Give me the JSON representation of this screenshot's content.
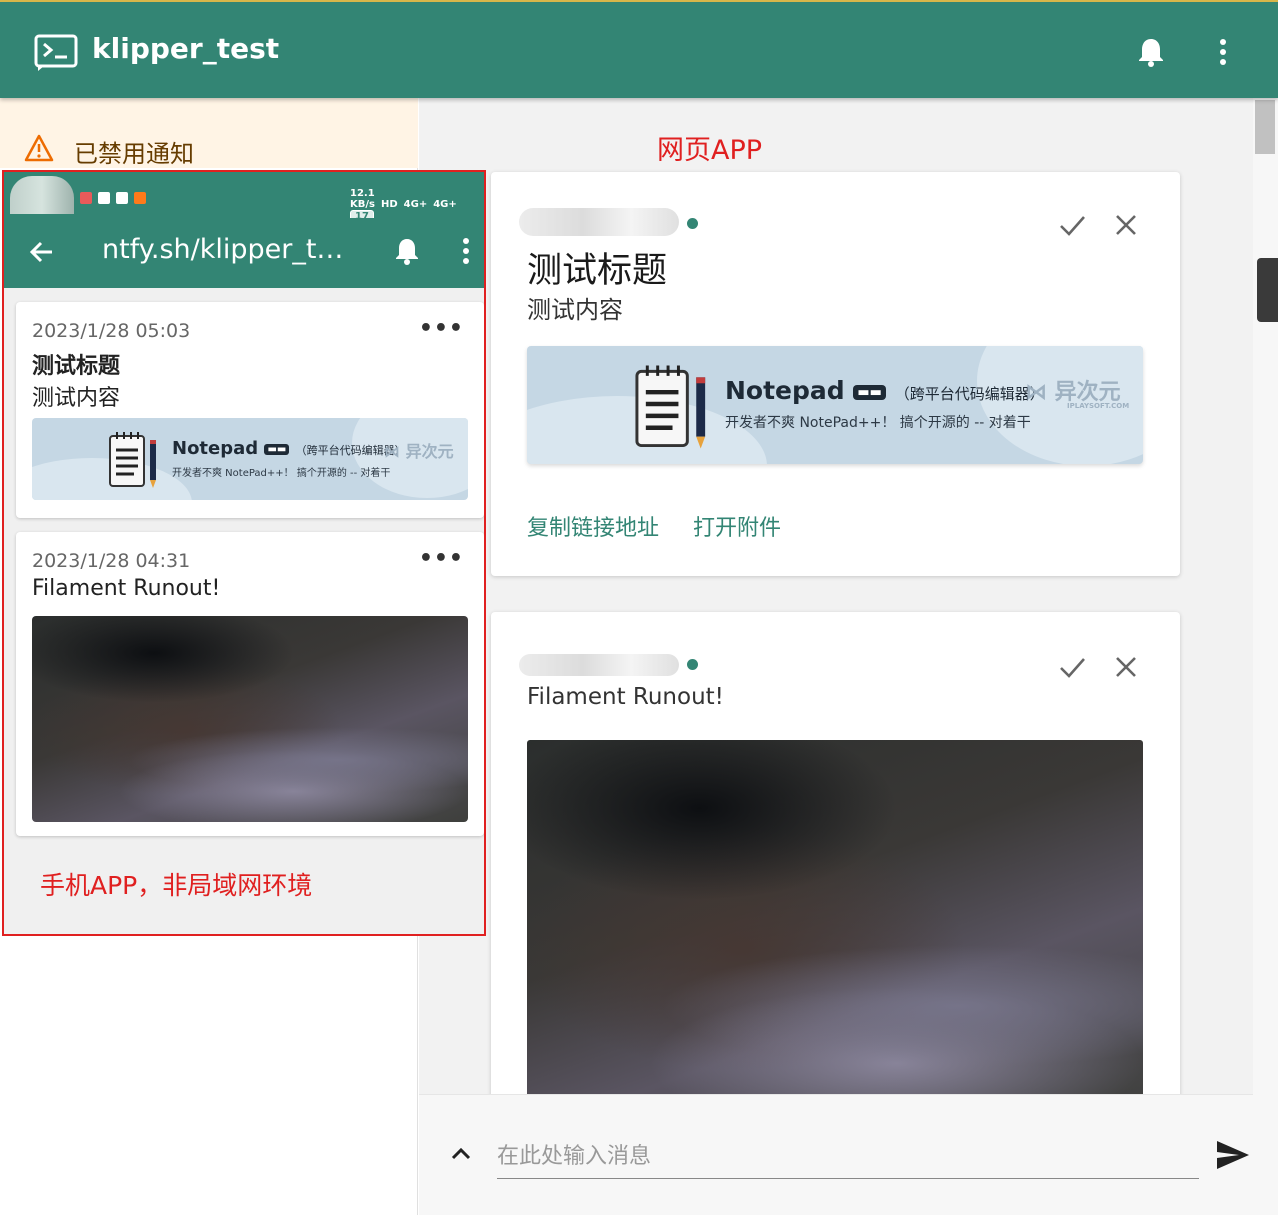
{
  "appbar": {
    "title": "klipper_test"
  },
  "sidebar": {
    "notice": "已禁用通知"
  },
  "phone": {
    "status_right": [
      "12.1 KB/s",
      "HD",
      "4G+",
      "4G+"
    ],
    "battery": "17",
    "title": "ntfy.sh/klipper_t…",
    "cards": [
      {
        "date": "2023/1/28 05:03",
        "title": "测试标题",
        "body": "测试内容"
      },
      {
        "date": "2023/1/28 04:31",
        "body": "Filament Runout!"
      }
    ],
    "note": "手机APP，非局域网环境"
  },
  "banner": {
    "title": "Notepad",
    "subtitle_cn": "（跨平台代码编辑器）",
    "tagline": "开发者不爽 NotePad++！ 搞个开源的 -- 对着干",
    "logo_text": "异次元",
    "logo_small": "IPLAYSOFT.COM"
  },
  "main": {
    "label": "网页APP",
    "cards": [
      {
        "title": "测试标题",
        "body": "测试内容",
        "actions": [
          "复制链接地址",
          "打开附件"
        ]
      },
      {
        "body": "Filament Runout!"
      }
    ]
  },
  "composer": {
    "placeholder": "在此处输入消息"
  },
  "colors": {
    "primary": "#338574",
    "annotation": "#e02020",
    "warning_bg": "#fff4e5"
  }
}
